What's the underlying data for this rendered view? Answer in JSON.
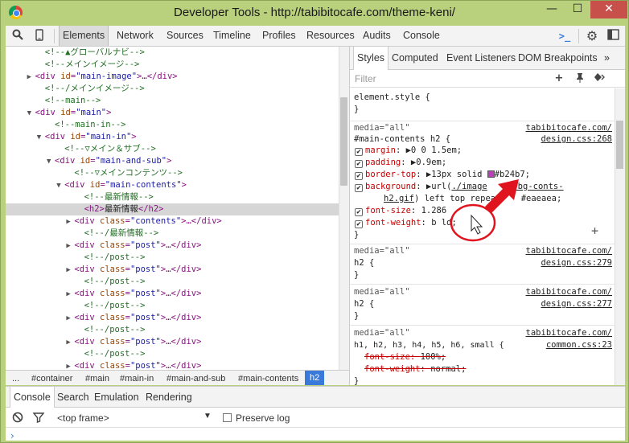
{
  "window": {
    "title": "Developer Tools - http://tabibitocafe.com/theme-keni/",
    "minimize": "—",
    "maximize": "☐",
    "close": "✕"
  },
  "toolbar": {
    "tabs": [
      "Elements",
      "Network",
      "Sources",
      "Timeline",
      "Profiles",
      "Resources",
      "Audits",
      "Console"
    ],
    "active_tab": "Elements",
    "console_icon": ">_"
  },
  "dom_tree": [
    {
      "indent": 4,
      "kind": "comment",
      "text": "<!--▲グローバルナビ-->"
    },
    {
      "indent": 4,
      "kind": "comment",
      "text": "<!--メインイメージ-->"
    },
    {
      "indent": 3,
      "kind": "tag",
      "tri": "▶",
      "open": "<div ",
      "attr": "id",
      "val": "\"main-image\"",
      "close": ">…</div>"
    },
    {
      "indent": 4,
      "kind": "comment",
      "text": "<!--/メインイメージ-->"
    },
    {
      "indent": 4,
      "kind": "comment",
      "text": "<!--main-->"
    },
    {
      "indent": 3,
      "kind": "tag",
      "tri": "▼",
      "open": "<div ",
      "attr": "id",
      "val": "\"main\"",
      "close": ">"
    },
    {
      "indent": 5,
      "kind": "comment",
      "text": "<!--main-in-->"
    },
    {
      "indent": 4,
      "kind": "tag",
      "tri": "▼",
      "open": "<div ",
      "attr": "id",
      "val": "\"main-in\"",
      "close": ">"
    },
    {
      "indent": 6,
      "kind": "comment",
      "text": "<!--▽メイン＆サブ-->"
    },
    {
      "indent": 5,
      "kind": "tag",
      "tri": "▼",
      "open": "<div ",
      "attr": "id",
      "val": "\"main-and-sub\"",
      "close": ">"
    },
    {
      "indent": 7,
      "kind": "comment",
      "text": "<!--▽メインコンテンツ-->"
    },
    {
      "indent": 6,
      "kind": "tag",
      "tri": "▼",
      "open": "<div ",
      "attr": "id",
      "val": "\"main-contents\"",
      "close": ">"
    },
    {
      "indent": 8,
      "kind": "comment",
      "text": "<!--最新情報-->"
    },
    {
      "indent": 8,
      "kind": "h2",
      "open": "<h2>",
      "text": "最新情報",
      "close": "</h2>",
      "selected": true
    },
    {
      "indent": 7,
      "kind": "tag",
      "tri": "▶",
      "open": "<div ",
      "attr": "class",
      "val": "\"contents\"",
      "close": ">…</div>"
    },
    {
      "indent": 8,
      "kind": "comment",
      "text": "<!--/最新情報-->"
    },
    {
      "indent": 7,
      "kind": "tag",
      "tri": "▶",
      "open": "<div ",
      "attr": "class",
      "val": "\"post\"",
      "close": ">…</div>"
    },
    {
      "indent": 8,
      "kind": "comment",
      "text": "<!--/post-->"
    },
    {
      "indent": 7,
      "kind": "tag",
      "tri": "▶",
      "open": "<div ",
      "attr": "class",
      "val": "\"post\"",
      "close": ">…</div>"
    },
    {
      "indent": 8,
      "kind": "comment",
      "text": "<!--/post-->"
    },
    {
      "indent": 7,
      "kind": "tag",
      "tri": "▶",
      "open": "<div ",
      "attr": "class",
      "val": "\"post\"",
      "close": ">…</div>"
    },
    {
      "indent": 8,
      "kind": "comment",
      "text": "<!--/post-->"
    },
    {
      "indent": 7,
      "kind": "tag",
      "tri": "▶",
      "open": "<div ",
      "attr": "class",
      "val": "\"post\"",
      "close": ">…</div>"
    },
    {
      "indent": 8,
      "kind": "comment",
      "text": "<!--/post-->"
    },
    {
      "indent": 7,
      "kind": "tag",
      "tri": "▶",
      "open": "<div ",
      "attr": "class",
      "val": "\"post\"",
      "close": ">…</div>"
    },
    {
      "indent": 8,
      "kind": "comment",
      "text": "<!--/post-->"
    },
    {
      "indent": 7,
      "kind": "tag",
      "tri": "▶",
      "open": "<div ",
      "attr": "class",
      "val": "\"post\"",
      "close": ">…</div>"
    }
  ],
  "breadcrumbs": [
    "...",
    "#container",
    "#main",
    "#main-in",
    "#main-and-sub",
    "#main-contents",
    "h2"
  ],
  "styles_panel": {
    "tabs": [
      "Styles",
      "Computed",
      "Event Listeners",
      "DOM Breakpoints"
    ],
    "active_tab": "Styles",
    "more": "»",
    "filter_placeholder": "Filter",
    "element_style_open": "element.style {",
    "rule_close": "}",
    "rule1": {
      "media": "media=\"all\"",
      "source_line1": "tabibitocafe.com/",
      "source_line2": "design.css:268",
      "selector": "#main-contents h2 {",
      "margin_name": "margin",
      "margin_val": "▶0 0 1.5em;",
      "padding_name": "padding",
      "padding_val": "▶0.9em;",
      "border_name": "border-top",
      "border_val_a": "▶13px solid ",
      "border_val_b": "#b24b7;",
      "bg_name": "background",
      "bg_val_a": "▶url(",
      "bg_link_a": "./image",
      "bg_link_b": "/bg-conts-",
      "bg_link_c": "h2.gif",
      "bg_val_b": ") left top repea",
      "bg_val_c": "#eaeaea;",
      "fs_name": "font-size",
      "fs_val": "1.286",
      "fw_name": "font-weight",
      "fw_val": "b",
      "fw_val_b": "ld;"
    },
    "rule2": {
      "media": "media=\"all\"",
      "source_line1": "tabibitocafe.com/",
      "source_line2": "design.css:279",
      "selector": "h2 {"
    },
    "rule3": {
      "media": "media=\"all\"",
      "source_line1": "tabibitocafe.com/",
      "source_line2": "design.css:277",
      "selector": "h2 {"
    },
    "rule4": {
      "media": "media=\"all\"",
      "source_line1": "tabibitocafe.com/",
      "source_line2": "common.css:23",
      "selector": "h1, h2, h3, h4, h5, h6, small {",
      "fs_name": "font-size",
      "fs_val": "100%;",
      "fw_name": "font-weight",
      "fw_val": "normal;"
    }
  },
  "drawer": {
    "tabs": [
      "Console",
      "Search",
      "Emulation",
      "Rendering"
    ],
    "active_tab": "Console",
    "frame_select": "<top frame>",
    "preserve_log": "Preserve log",
    "prompt": "›"
  },
  "colors": {
    "window_frame": "#b9d07d",
    "close_button": "#c7504a",
    "selection": "#3879d9",
    "annotation": "#e0141e"
  }
}
